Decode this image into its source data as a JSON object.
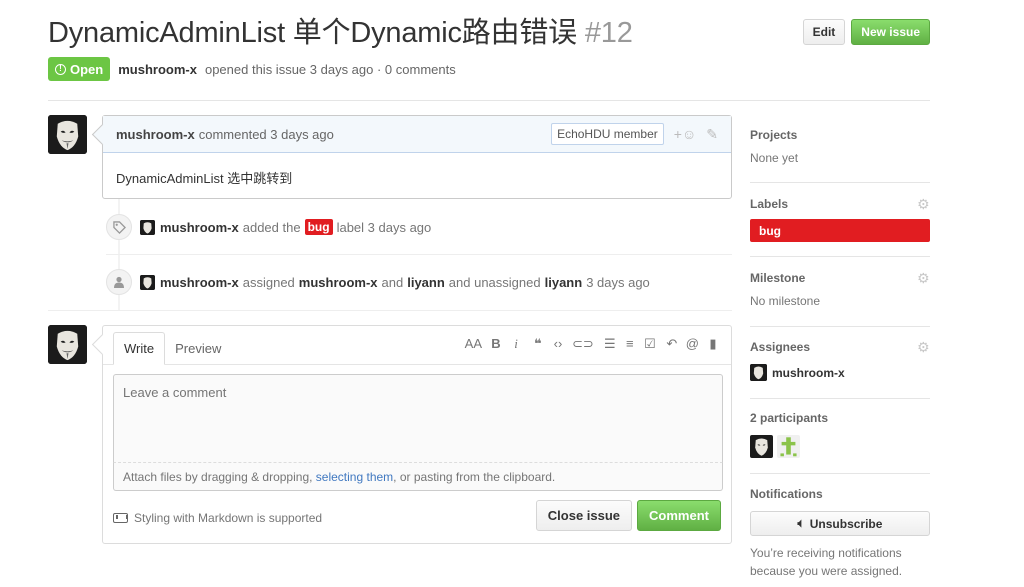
{
  "issue": {
    "title": "DynamicAdminList 单个Dynamic路由错误",
    "number": "#12",
    "state": "Open",
    "author": "mushroom-x",
    "opened_text": "opened this issue 3 days ago · 0 comments"
  },
  "header": {
    "edit_label": "Edit",
    "new_issue_label": "New issue"
  },
  "comment": {
    "author": "mushroom-x",
    "action": "commented 3 days ago",
    "badge": "EchoHDU member",
    "body": "DynamicAdminList 选中跳转到"
  },
  "events": {
    "label_event": {
      "actor": "mushroom-x",
      "text_before": "added the",
      "label": "bug",
      "text_after": "label 3 days ago"
    },
    "assign_event": {
      "actor": "mushroom-x",
      "t1": "assigned",
      "assignee": "mushroom-x",
      "t2": "and",
      "assignee2": "liyann",
      "t3": "and unassigned",
      "unassigned": "liyann",
      "t4": "3 days ago"
    }
  },
  "composer": {
    "tab_write": "Write",
    "tab_preview": "Preview",
    "placeholder": "Leave a comment",
    "attach_before": "Attach files by dragging & dropping,",
    "attach_link": "selecting them",
    "attach_after": ", or pasting from the clipboard.",
    "markdown_note": "Styling with Markdown is supported",
    "close_label": "Close issue",
    "comment_label": "Comment",
    "toolbar": {
      "heading": "AA",
      "bold": "B",
      "italic": "i"
    }
  },
  "sidebar": {
    "projects": {
      "title": "Projects",
      "value": "None yet"
    },
    "labels": {
      "title": "Labels",
      "items": [
        "bug"
      ]
    },
    "milestone": {
      "title": "Milestone",
      "value": "No milestone"
    },
    "assignees": {
      "title": "Assignees",
      "items": [
        "mushroom-x"
      ]
    },
    "participants": {
      "title": "2 participants"
    },
    "notifications": {
      "title": "Notifications",
      "button": "Unsubscribe",
      "text": "You’re receiving notifications because you were assigned."
    }
  },
  "colors": {
    "open_green": "#6cc644",
    "bug_red": "#e11d21",
    "link_blue": "#4078c0"
  }
}
